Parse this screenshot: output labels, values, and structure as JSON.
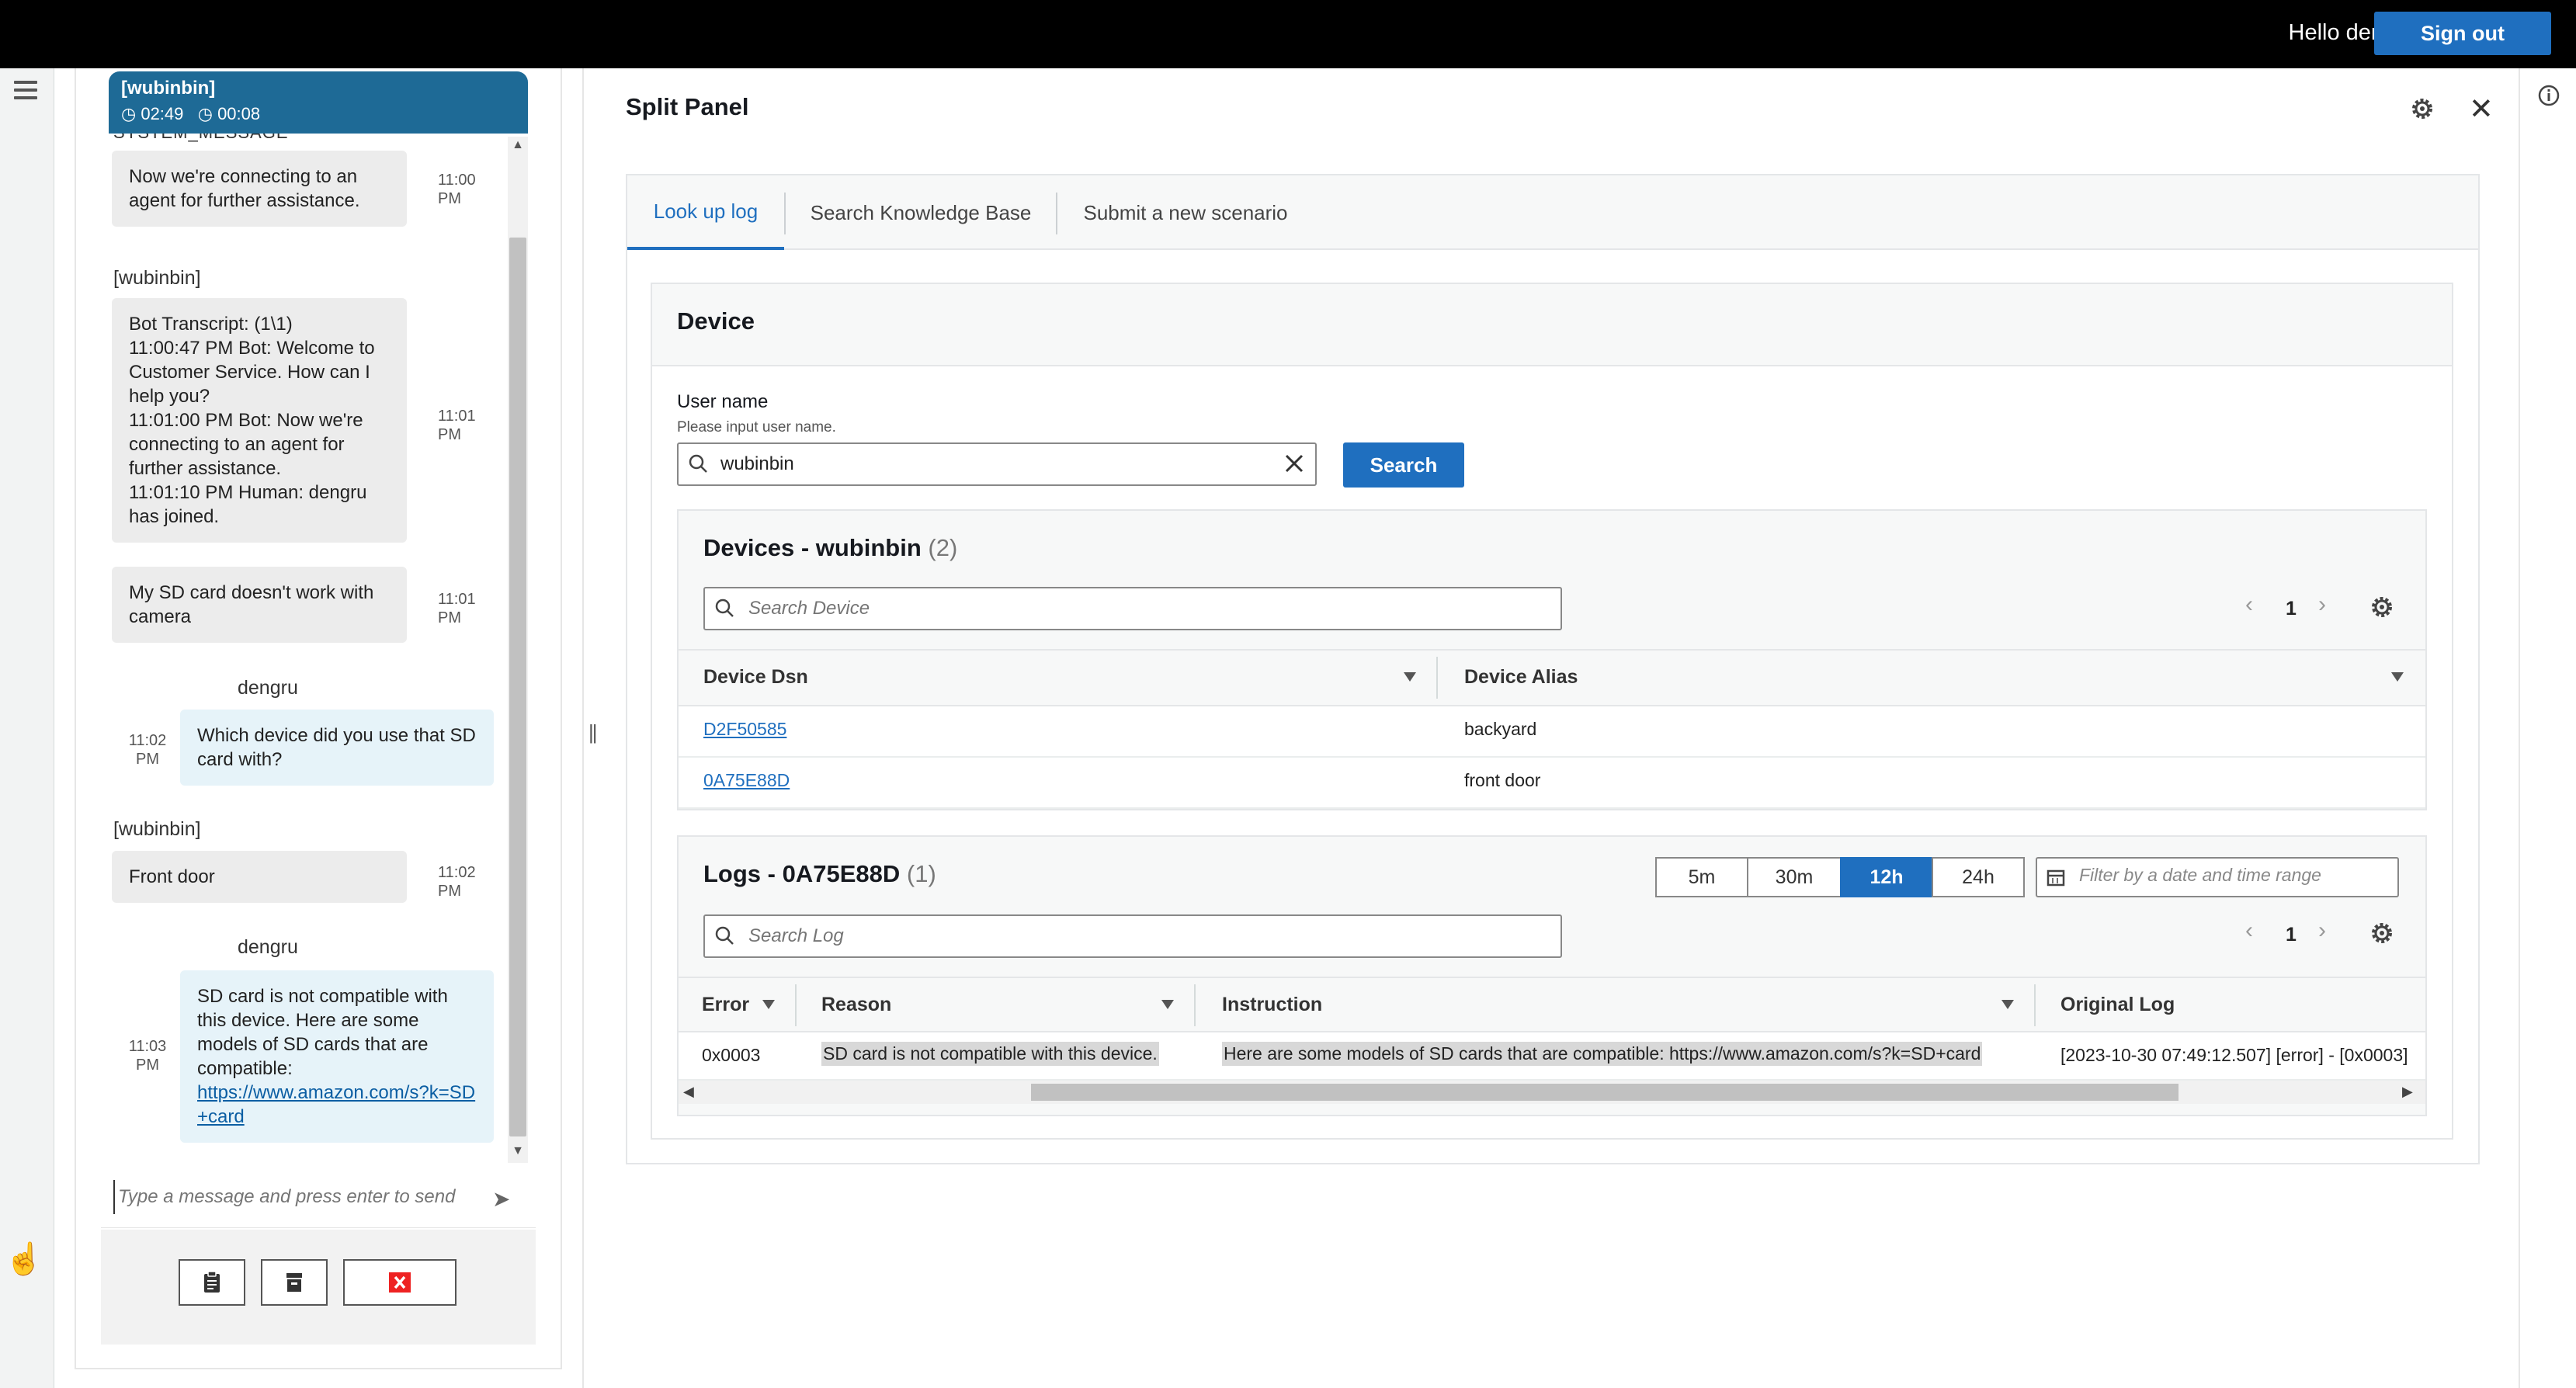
{
  "topbar": {
    "greeting": "Hello dengru!",
    "signout_label": "Sign out"
  },
  "chat": {
    "header_name": "[wubinbin]",
    "timer_total": "02:49",
    "timer_wait": "00:08",
    "system_label": "SYSTEM_MESSAGE",
    "messages": [
      {
        "text": "Now we're connecting to an agent for further assistance.",
        "time": "11:00 PM"
      },
      {
        "sender": "[wubinbin]",
        "lines": [
          "Bot Transcript: (1\\1)",
          "11:00:47 PM Bot: Welcome to",
          "Customer Service. How can I",
          "help you?",
          "11:01:00 PM Bot: Now we're",
          "connecting to an agent for",
          "further assistance.",
          "11:01:10 PM Human: dengru",
          "has joined."
        ],
        "time": "11:01 PM"
      },
      {
        "text": "My SD card doesn't work with camera",
        "time": "11:01 PM"
      },
      {
        "sender": "dengru",
        "text": "Which device did you use that SD card with?",
        "time": "11:02 PM"
      },
      {
        "sender": "[wubinbin]",
        "text": "Front door",
        "time": "11:02 PM"
      },
      {
        "sender": "dengru",
        "text": "SD card is not compatible with this device. Here are some models of SD cards that are compatible:",
        "link": "https://www.amazon.com/s?k=SD+card",
        "time": "11:03 PM"
      }
    ],
    "input_placeholder": "Type a message and press enter to send"
  },
  "split": {
    "title": "Split Panel",
    "tabs": [
      {
        "label": "Look up log",
        "active": true
      },
      {
        "label": "Search Knowledge Base",
        "active": false
      },
      {
        "label": "Submit a new scenario",
        "active": false
      }
    ],
    "device": {
      "title": "Device",
      "user_label": "User name",
      "user_hint": "Please input user name.",
      "user_value": "wubinbin",
      "search_label": "Search"
    },
    "devices": {
      "title": "Devices - wubinbin",
      "count": "(2)",
      "search_placeholder": "Search Device",
      "page": "1",
      "columns": [
        "Device Dsn",
        "Device Alias"
      ],
      "rows": [
        {
          "dsn": "D2F50585",
          "alias": "backyard"
        },
        {
          "dsn": "0A75E88D",
          "alias": "front door"
        }
      ]
    },
    "logs": {
      "title": "Logs - 0A75E88D",
      "count": "(1)",
      "ranges": [
        "5m",
        "30m",
        "12h",
        "24h"
      ],
      "active_range": "12h",
      "date_placeholder": "Filter by a date and time range",
      "search_placeholder": "Search Log",
      "page": "1",
      "columns": [
        "Error",
        "Reason",
        "Instruction",
        "Original Log"
      ],
      "rows": [
        {
          "error": "0x0003",
          "reason": "SD card is not compatible with this device.",
          "instruction": "Here are some models of SD cards that are compatible: https://www.amazon.com/s?k=SD+card",
          "original": "[2023-10-30 07:49:12.507] [error] - [0x0003]"
        }
      ]
    }
  },
  "colors": {
    "accent": "#1f6fbf",
    "chat_header": "#1e6a96",
    "topbar": "#000000"
  },
  "icons": [
    "hamburger-icon",
    "clock-icon",
    "timer-icon",
    "send-icon",
    "notes-icon",
    "archive-icon",
    "end-chat-icon",
    "gear-icon",
    "close-icon",
    "info-icon",
    "search-icon",
    "clear-icon",
    "calendar-icon",
    "chevron-left-icon",
    "chevron-right-icon",
    "caret-down-icon",
    "pointer-cursor-icon"
  ]
}
